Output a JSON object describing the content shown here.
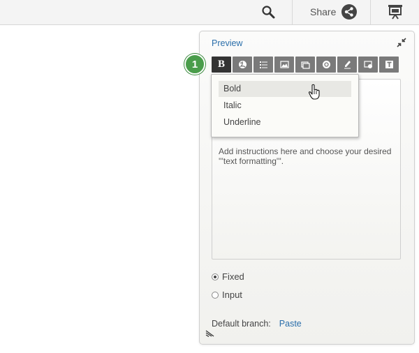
{
  "topbar": {
    "search_icon": "search-icon",
    "share_label": "Share",
    "share_icon": "share-icon",
    "present_icon": "presentation-icon"
  },
  "panel": {
    "title": "Preview",
    "collapse_icon": "collapse-icon",
    "toolbar": [
      {
        "name": "bold",
        "label": "B",
        "active": true
      },
      {
        "name": "globe",
        "icon": "globe-icon"
      },
      {
        "name": "list",
        "icon": "list-icon"
      },
      {
        "name": "image",
        "icon": "image-icon"
      },
      {
        "name": "gallery",
        "icon": "gallery-icon"
      },
      {
        "name": "tag",
        "icon": "tag-icon"
      },
      {
        "name": "pen",
        "icon": "pen-icon"
      },
      {
        "name": "media",
        "icon": "media-icon"
      },
      {
        "name": "text",
        "icon": "text-icon"
      }
    ],
    "step_badge": "1",
    "editor_text": "Add instructions here and choose your desired '''text formatting'''.",
    "dropdown": {
      "items": [
        "Bold",
        "Italic",
        "Underline"
      ],
      "hovered": "Bold"
    },
    "radios": [
      {
        "label": "Fixed",
        "checked": true
      },
      {
        "label": "Input",
        "checked": false
      }
    ],
    "default_branch_label": "Default branch:",
    "default_branch_link": "Paste"
  },
  "colors": {
    "link": "#2a6eaa",
    "toolbar_button": "#7a7a7a",
    "toolbar_active": "#333333",
    "badge": "#4a9d4b"
  }
}
